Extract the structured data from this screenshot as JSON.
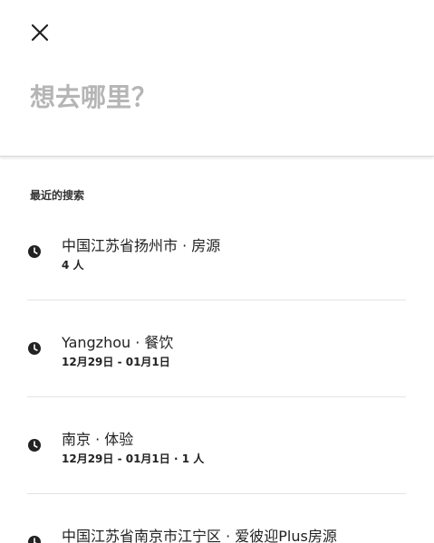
{
  "search": {
    "placeholder": "想去哪里？",
    "value": ""
  },
  "recent": {
    "header": "最近的搜索",
    "items": [
      {
        "title": "中国江苏省扬州市 · 房源",
        "subtitle": "4 人",
        "icon": "clock-icon"
      },
      {
        "title": "Yangzhou · 餐饮",
        "subtitle": "12月29日 - 01月1日",
        "icon": "clock-icon"
      },
      {
        "title": "南京 · 体验",
        "subtitle": "12月29日 - 01月1日 · 1 人",
        "icon": "clock-icon"
      },
      {
        "title": "中国江苏省南京市江宁区 · 爱彼迎Plus房源",
        "subtitle": "",
        "icon": "clock-icon"
      }
    ]
  }
}
